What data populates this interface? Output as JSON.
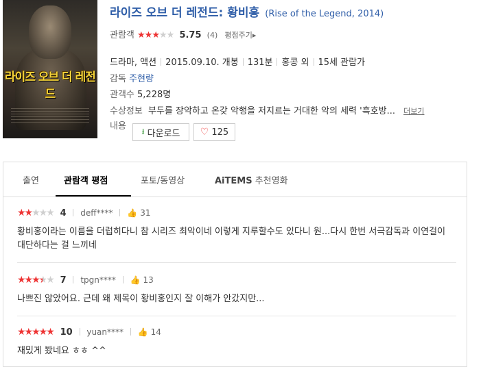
{
  "movie": {
    "title": "라이즈 오브 더 레전드: 황비홍",
    "title_en": "(Rise of the Legend, 2014)",
    "rating_label": "관람객",
    "rating_stars": 3,
    "score": "5.75",
    "rating_count": "(4)",
    "rate_link": "평점주기▸",
    "genre": "드라마, 액션",
    "release": "2015.09.10. 개봉",
    "runtime": "131분",
    "country": "홍콩 외",
    "age": "15세 관람가",
    "director_label": "감독",
    "director": "주현량",
    "audience_label": "관객수",
    "audience": "5,228명",
    "awards_label": "수상정보",
    "plot": "부두를 장악하고 온갖 악행을 저지르는 거대한 악의 세력 '흑호방...",
    "more_link": "더보기",
    "content_label": "내용",
    "download_label": "다운로드",
    "like_count": "125",
    "poster_title": "라이즈 오브 더 레전드"
  },
  "tabs": [
    {
      "label": "출연"
    },
    {
      "label": "관람객 평점"
    },
    {
      "label": "포토/동영상"
    },
    {
      "label_brand": "AiTEMS",
      "label": "추천영화"
    }
  ],
  "reviews": [
    {
      "stars": 2,
      "score": "4",
      "user": "deff****",
      "likes": "31",
      "text": "황비홍이라는 이름을 더럽히다니 참 시리즈 최악이네 이렇게 지루할수도 있다니 원...다시 한번 서극감독과 이연걸이 대단하다는 걸 느끼네"
    },
    {
      "stars": 3.5,
      "score": "7",
      "user": "tpgn****",
      "likes": "13",
      "text": "나쁘진 않았어요. 근데 왜 제목이 황비홍인지 잘 이해가 안갔지만..."
    },
    {
      "stars": 5,
      "score": "10",
      "user": "yuan****",
      "likes": "14",
      "text": "재밌게 봤네요 ㅎㅎ ^^"
    }
  ],
  "colors": {
    "accent": "#2f5ea8",
    "star": "#ee3333",
    "download_icon": "#3a9a3a"
  }
}
